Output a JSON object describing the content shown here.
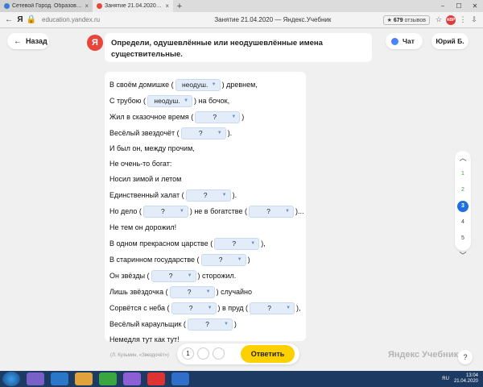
{
  "browser": {
    "tabs": [
      {
        "label": "Сетевой Город. Образова...",
        "close": "×"
      },
      {
        "label": "Занятие 21.04.2020 — Я...",
        "close": "×"
      }
    ],
    "new_tab": "+",
    "window_controls": [
      "⎯",
      "☐",
      "✕"
    ],
    "back": "←",
    "logo": "Я",
    "url": "education.yandex.ru",
    "page_title": "Занятие 21.04.2020 — Яндекс.Учебник",
    "reviews_star": "★",
    "reviews_count": "679",
    "reviews_label": "отзывов",
    "bookmark": "☆",
    "adblock": "ABP",
    "menu": "⋮",
    "download": "⇩"
  },
  "header": {
    "back_label": "Назад",
    "back_arrow": "←",
    "avatar_letter": "Я",
    "instruction": "Определи, одушевлённые или неодушевлённые имена существительные.",
    "chat_label": "Чат",
    "user_label": "Юрий Б."
  },
  "exercise": {
    "lines": [
      {
        "parts": [
          {
            "t": "В своём домишке ("
          },
          {
            "dd": "неодуш."
          },
          {
            "t": ") древнем,"
          }
        ]
      },
      {
        "parts": [
          {
            "t": "С трубою ("
          },
          {
            "dd": "неодуш."
          },
          {
            "t": ") на бочок,"
          }
        ]
      },
      {
        "parts": [
          {
            "t": "Жил в сказочное время ("
          },
          {
            "dd": "?"
          },
          {
            "t": ")"
          }
        ]
      },
      {
        "parts": [
          {
            "t": "Весёлый звездочёт ("
          },
          {
            "dd": "?"
          },
          {
            "t": ")."
          }
        ]
      },
      {
        "parts": [
          {
            "t": "И был он, между прочим,"
          }
        ]
      },
      {
        "parts": [
          {
            "t": "Не очень-то богат:"
          }
        ]
      },
      {
        "parts": [
          {
            "t": "Носил зимой и летом"
          }
        ]
      },
      {
        "parts": [
          {
            "t": "Единственный халат ("
          },
          {
            "dd": "?"
          },
          {
            "t": ")."
          }
        ]
      },
      {
        "parts": [
          {
            "t": "Но дело ("
          },
          {
            "dd": "?"
          },
          {
            "t": ") не в богатстве ("
          },
          {
            "dd": "?"
          },
          {
            "t": ")..."
          }
        ]
      },
      {
        "parts": [
          {
            "t": "Не тем он дорожил!"
          }
        ]
      },
      {
        "parts": [
          {
            "t": "В одном прекрасном царстве ("
          },
          {
            "dd": "?"
          },
          {
            "t": "),"
          }
        ]
      },
      {
        "parts": [
          {
            "t": "В старинном государстве ("
          },
          {
            "dd": "?"
          },
          {
            "t": ")"
          }
        ]
      },
      {
        "parts": [
          {
            "t": "Он звёзды ("
          },
          {
            "dd": "?"
          },
          {
            "t": ") сторожил."
          }
        ]
      },
      {
        "parts": [
          {
            "t": "Лишь звёздочка ("
          },
          {
            "dd": "?"
          },
          {
            "t": ") случайно"
          }
        ]
      },
      {
        "parts": [
          {
            "t": "Сорвётся с неба ("
          },
          {
            "dd": "?"
          },
          {
            "t": ") в пруд ("
          },
          {
            "dd": "?"
          },
          {
            "t": "),"
          }
        ]
      },
      {
        "parts": [
          {
            "t": "Весёлый караульщик ("
          },
          {
            "dd": "?"
          },
          {
            "t": ")"
          }
        ]
      },
      {
        "parts": [
          {
            "t": "Немедля тут как тут!"
          }
        ]
      }
    ],
    "caption": "(Л. Кузьмин, «Звездочёт»)"
  },
  "answer_bar": {
    "attempts": [
      "1",
      "",
      ""
    ],
    "submit_label": "Ответить"
  },
  "side_nav": {
    "up": "︿",
    "down": "﹀",
    "items": [
      {
        "label": "1",
        "state": "done"
      },
      {
        "label": "2",
        "state": "done"
      },
      {
        "label": "3",
        "state": "current"
      },
      {
        "label": "4",
        "state": "todo"
      },
      {
        "label": "5",
        "state": "todo"
      }
    ]
  },
  "brand": "Яндекс Учебник",
  "help_label": "?",
  "taskbar": {
    "lang": "RU",
    "time": "13:04",
    "date": "21.04.2020"
  },
  "colors": {
    "accent_yellow": "#fdd000",
    "ya_red": "#e8453c",
    "current_blue": "#1f6fe0",
    "done_green": "#3aa640",
    "dropdown_bg": "#e3edf9"
  }
}
